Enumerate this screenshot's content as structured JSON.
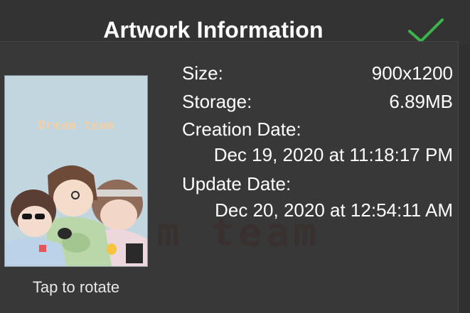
{
  "header": {
    "title": "Artwork Information",
    "confirm_icon": "checkmark-icon",
    "accent_color": "#3bb54a"
  },
  "artwork": {
    "thumbnail_title": "Dream team",
    "watermark_text": "m  team",
    "rotate_hint": "Tap to rotate"
  },
  "info": {
    "size_label": "Size:",
    "size_value": "900x1200",
    "storage_label": "Storage:",
    "storage_value": "6.89MB",
    "creation_label": "Creation Date:",
    "creation_value": "Dec 19, 2020 at 11:18:17 PM",
    "update_label": "Update Date:",
    "update_value": "Dec 20, 2020 at 12:54:11 AM"
  }
}
